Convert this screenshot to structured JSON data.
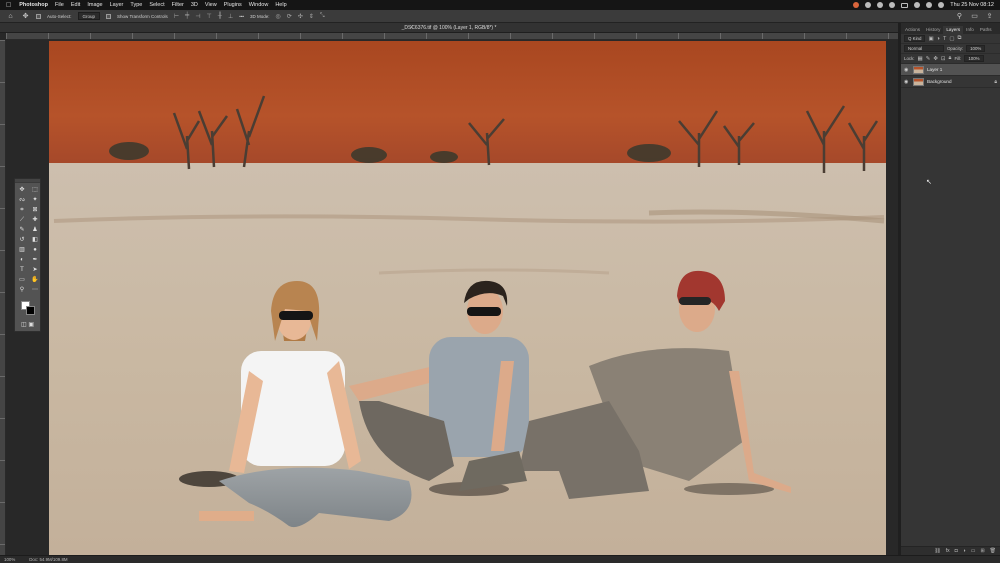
{
  "menubar": {
    "apple": "",
    "items": [
      "Photoshop",
      "File",
      "Edit",
      "Image",
      "Layer",
      "Type",
      "Select",
      "Filter",
      "3D",
      "View",
      "Plugins",
      "Window",
      "Help"
    ],
    "clock": "Thu 25 Nov  08:12"
  },
  "options": {
    "auto_select_label": "Auto-Select:",
    "auto_select_value": "Group",
    "transform_label": "Show Transform Controls",
    "more": "•••",
    "mode_3d": "3D Mode:"
  },
  "document": {
    "tab_title": "_DSC6376.tif @ 100% (Layer 1, RGB/8*) *",
    "close_glyph": "×"
  },
  "panel": {
    "tabs": [
      "Actions",
      "History",
      "Layers",
      "Info",
      "Paths"
    ],
    "active_tab": "Layers",
    "kind_label": "Q Kind",
    "blend_mode": "Normal",
    "opacity_label": "Opacity:",
    "opacity_value": "100%",
    "lock_label": "Lock:",
    "fill_label": "Fill:",
    "fill_value": "100%",
    "layers": [
      {
        "name": "Layer 1",
        "selected": true
      },
      {
        "name": "Background",
        "locked": true
      }
    ]
  },
  "status": {
    "zoom": "100%",
    "doc": "Doc: 54.9M/109.8M"
  },
  "colors": {
    "foreground": "#ffffff",
    "background": "#000000",
    "dune": "#b04a22",
    "pan": "#c8b79f"
  }
}
